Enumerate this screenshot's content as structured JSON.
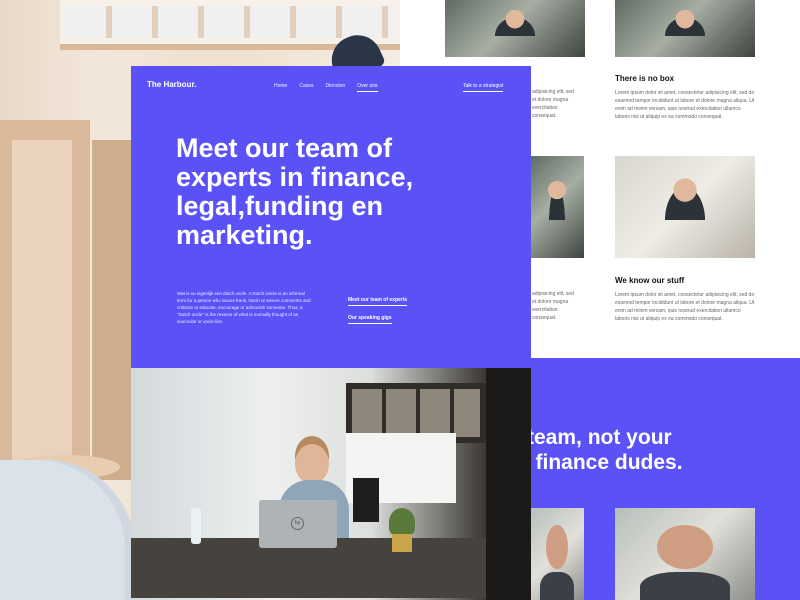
{
  "card": {
    "logo": "The Harbour.",
    "nav": [
      "Home",
      "Cases",
      "Diensten",
      "Over ons"
    ],
    "nav_active_index": 3,
    "cta_top": "Talk to a strategist",
    "hero": [
      "Meet our team of",
      "experts in finance,",
      "legal,funding en",
      "marketing."
    ],
    "intro": "Wat is nu eigenlijk een dutch uncle. A Dutch Uncle is an informal term for a person who issues frank, harsh or severe comments and criticism to educate, encourage or admonish someone. Thus, a \"Dutch uncle\" is the reverse of what is normally thought of as avuncular or uncle-like.",
    "link_team": "Meet our team of experts",
    "link_gigs": "Our speaking gigs"
  },
  "right": {
    "block1_title": "There is no box",
    "block2_title": "We know our stuff",
    "lorem": "Lorem ipsum dolor sit amet, consectetur adipisicing elit, sed do eiusmod tempor incididunt ut labore et dolore magna aliqua. Ut enim ad minim veniam, quis nostrud exercitation ullamco laboris nisi ut aliquip ex ea commodo consequat.",
    "partial_lorem": "adipisicing elit, sed et dolore magna exercitation consequat.",
    "band_heading": [
      "r team, not your",
      "e finance dudes."
    ]
  },
  "colors": {
    "accent": "#5a52f7"
  }
}
